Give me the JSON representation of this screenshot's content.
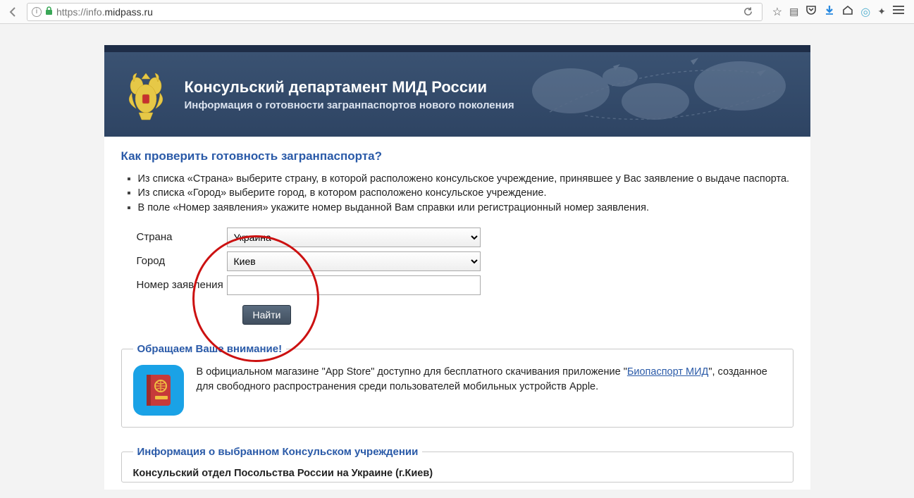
{
  "browser": {
    "url_display_prefix": "https://",
    "url_host_pre": "info.",
    "url_host_main": "midpass.ru"
  },
  "header": {
    "title": "Консульский департамент МИД России",
    "subtitle": "Информация о готовности загранпаспортов нового поколения"
  },
  "instructions": {
    "heading": "Как проверить готовность загранпаспорта?",
    "items": [
      "Из списка «Страна» выберите страну, в которой расположено консульское учреждение, принявшее у Вас заявление о выдаче паспорта.",
      "Из списка «Город» выберите город, в котором расположено консульское учреждение.",
      "В поле «Номер заявления» укажите номер выданной Вам справки или регистрационный номер заявления."
    ]
  },
  "form": {
    "country_label": "Страна",
    "country_value": "Украина",
    "city_label": "Город",
    "city_value": "Киев",
    "appnum_label": "Номер заявления",
    "appnum_value": "",
    "submit_label": "Найти"
  },
  "notice": {
    "legend": "Обращаем Ваше внимание!",
    "text_before": "В официальном магазине \"App Store\" доступно для бесплатного скачивания приложение \"",
    "link_label": "Биопаспорт МИД",
    "text_after": "\", созданное для свободного распространения среди пользователей мобильных устройств Apple."
  },
  "consulate": {
    "legend": "Информация о выбранном Консульском учреждении",
    "title": "Консульский отдел Посольства России на Украине (г.Киев)"
  }
}
